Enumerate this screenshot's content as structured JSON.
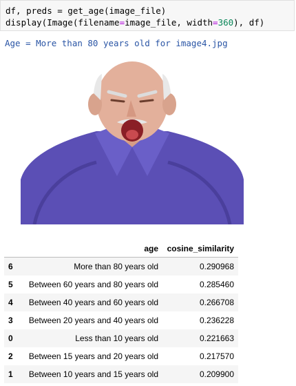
{
  "code": {
    "line1_prefix": "df, preds = get_age(image_file)",
    "line2_a": "display(Image(filename",
    "line2_eq1": "=",
    "line2_b": "image_file, width",
    "line2_eq2": "=",
    "line2_num": "360",
    "line2_c": "), df)"
  },
  "output": {
    "stdout": "Age = More than 80 years old for image4.jpg"
  },
  "image": {
    "subject": "elderly-man-yelling-photo",
    "shirt_color": "#5b4fb5",
    "skin_color": "#e3b09b"
  },
  "table": {
    "headers": [
      "",
      "age",
      "cosine_similarity"
    ],
    "rows": [
      {
        "index": "6",
        "age": "More than 80 years old",
        "cosine_similarity": "0.290968"
      },
      {
        "index": "5",
        "age": "Between 60 years and 80 years old",
        "cosine_similarity": "0.285460"
      },
      {
        "index": "4",
        "age": "Between 40 years and 60 years old",
        "cosine_similarity": "0.266708"
      },
      {
        "index": "3",
        "age": "Between 20 years and 40 years old",
        "cosine_similarity": "0.236228"
      },
      {
        "index": "0",
        "age": "Less than 10 years old",
        "cosine_similarity": "0.221663"
      },
      {
        "index": "2",
        "age": "Between 15 years and 20 years old",
        "cosine_similarity": "0.217570"
      },
      {
        "index": "1",
        "age": "Between 10 years and 15 years old",
        "cosine_similarity": "0.209900"
      }
    ]
  }
}
